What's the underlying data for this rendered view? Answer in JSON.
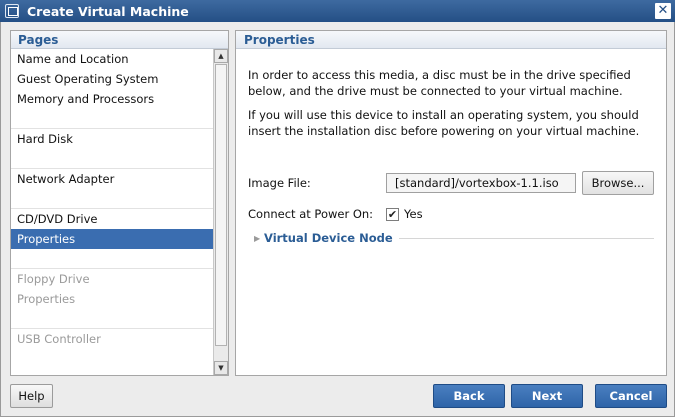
{
  "window": {
    "title": "Create Virtual Machine",
    "close_glyph": "✕"
  },
  "left_panel": {
    "header": "Pages",
    "items": [
      {
        "label": "Name and Location",
        "state": "normal"
      },
      {
        "label": "Guest Operating System",
        "state": "normal"
      },
      {
        "label": "Memory and Processors",
        "state": "normal"
      },
      {
        "label": "Hard Disk",
        "state": "normal"
      },
      {
        "label": "Network Adapter",
        "state": "normal"
      },
      {
        "label": "CD/DVD Drive",
        "state": "normal"
      },
      {
        "label": "Properties",
        "state": "selected"
      },
      {
        "label": "Floppy Drive",
        "state": "disabled"
      },
      {
        "label": "Properties",
        "state": "disabled"
      },
      {
        "label": "USB Controller",
        "state": "disabled"
      }
    ]
  },
  "right_panel": {
    "header": "Properties",
    "para1": "In order to access this media, a disc must be in the drive specified below, and the drive must be connected to your virtual machine.",
    "para2": "If you will use this device to install an operating system, you should insert the installation disc before powering on your virtual machine.",
    "image_file_label": "Image File:",
    "image_file_value": "[standard]/vortexbox-1.1.iso",
    "browse_label": "Browse...",
    "connect_label": "Connect at Power On:",
    "connect_checked": true,
    "connect_value_label": "Yes",
    "virtual_device_node_label": "Virtual Device Node"
  },
  "buttons": {
    "help": "Help",
    "back": "Back",
    "next": "Next",
    "cancel": "Cancel"
  },
  "colors": {
    "title_bar": "#2f5c93",
    "selection": "#3a6db0",
    "accent_text": "#2b5d95",
    "primary_button": "#3a71b4"
  }
}
